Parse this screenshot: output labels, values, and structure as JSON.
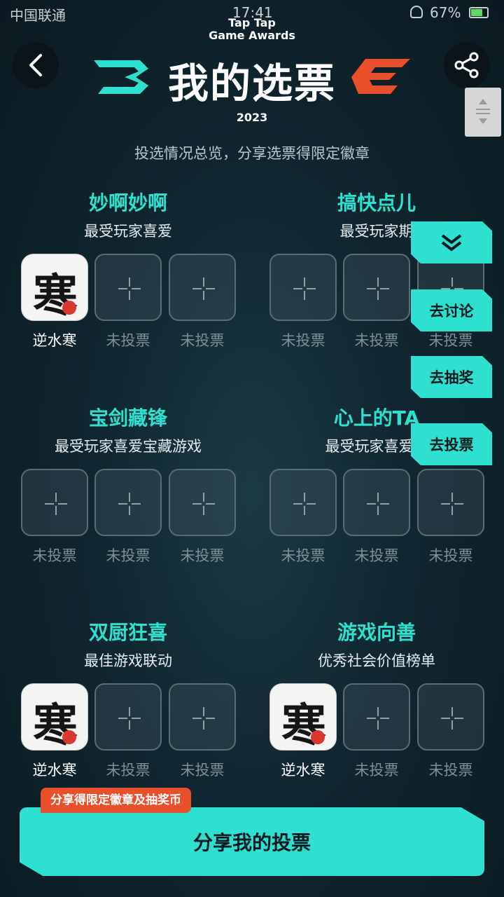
{
  "status_bar": {
    "carrier": "中国联通",
    "time": "17:41",
    "battery": "67%"
  },
  "header": {
    "brand_line1": "Tap Tap",
    "brand_line2": "Game Awards",
    "title": "我的选票",
    "year": "2023",
    "subtitle": "投选情况总览，分享选票得限定徽章"
  },
  "categories": [
    {
      "title": "妙啊妙啊",
      "subtitle": "最受玩家喜爱",
      "slots": [
        {
          "voted": true,
          "label": "逆水寒",
          "icon": "nishuihan-game-icon"
        },
        {
          "voted": false,
          "label": "未投票"
        },
        {
          "voted": false,
          "label": "未投票"
        }
      ]
    },
    {
      "title": "搞快点儿",
      "subtitle": "最受玩家期",
      "slots": [
        {
          "voted": false,
          "label": "未投票"
        },
        {
          "voted": false,
          "label": "未投票"
        },
        {
          "voted": false,
          "label": "未投票"
        }
      ]
    },
    {
      "title": "宝剑藏锋",
      "subtitle": "最受玩家喜爱宝藏游戏",
      "slots": [
        {
          "voted": false,
          "label": "未投票"
        },
        {
          "voted": false,
          "label": "未投票"
        },
        {
          "voted": false,
          "label": "未投票"
        }
      ]
    },
    {
      "title": "心上的TA",
      "subtitle": "最受玩家喜爱角",
      "slots": [
        {
          "voted": false,
          "label": "未投票"
        },
        {
          "voted": false,
          "label": "未投票"
        },
        {
          "voted": false,
          "label": "未投票"
        }
      ]
    },
    {
      "title": "双厨狂喜",
      "subtitle": "最佳游戏联动",
      "slots": [
        {
          "voted": true,
          "label": "逆水寒",
          "icon": "nishuihan-game-icon"
        },
        {
          "voted": false,
          "label": "未投票"
        },
        {
          "voted": false,
          "label": "未投票"
        }
      ]
    },
    {
      "title": "游戏向善",
      "subtitle": "优秀社会价值榜单",
      "slots": [
        {
          "voted": true,
          "label": "逆水寒",
          "icon": "nishuihan-game-icon"
        },
        {
          "voted": false,
          "label": "未投票"
        },
        {
          "voted": false,
          "label": "未投票"
        }
      ]
    }
  ],
  "game_icon_glyph": "寒",
  "float_buttons": {
    "discuss": "去讨论",
    "lottery": "去抽奖",
    "vote": "去投票"
  },
  "footer": {
    "reward_tag": "分享得限定徽章及抽奖币",
    "share_button": "分享我的投票"
  },
  "colors": {
    "accent": "#2ee0cf",
    "orange": "#e8502b",
    "background": "#102630"
  }
}
